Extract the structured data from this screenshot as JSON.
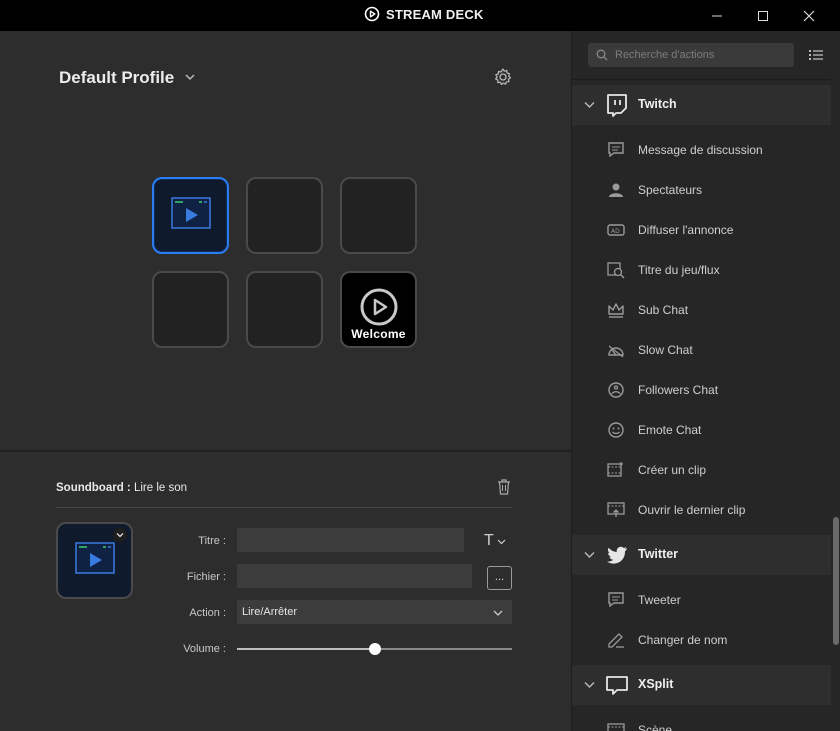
{
  "window": {
    "title": "STREAM DECK",
    "minimize_icon": "minimize-icon",
    "maximize_icon": "maximize-icon",
    "close_icon": "close-icon"
  },
  "profile": {
    "name": "Default Profile"
  },
  "keys": [
    {
      "state": "selected",
      "icon": "video-player-icon"
    },
    {
      "state": "empty"
    },
    {
      "state": "empty"
    },
    {
      "state": "empty"
    },
    {
      "state": "empty"
    },
    {
      "state": "welcome",
      "icon": "elgato-logo-icon",
      "label": "Welcome"
    }
  ],
  "properties": {
    "plugin": "Soundboard :",
    "action_name": "Lire le son",
    "fields": {
      "title_label": "Titre :",
      "title_value": "",
      "file_label": "Fichier :",
      "file_value": "",
      "browse_label": "...",
      "action_label": "Action :",
      "action_value": "Lire/Arrêter",
      "volume_label": "Volume :",
      "volume_level": 0.5
    },
    "title_font_button": "T"
  },
  "sidebar": {
    "search_placeholder": "Recherche d'actions",
    "categories": [
      {
        "name": "Twitch",
        "icon": "twitch-icon",
        "items": [
          {
            "label": "Message de discussion",
            "icon": "chat-message-icon"
          },
          {
            "label": "Spectateurs",
            "icon": "viewers-icon"
          },
          {
            "label": "Diffuser l'annonce",
            "icon": "ad-broadcast-icon"
          },
          {
            "label": "Titre du jeu/flux",
            "icon": "stream-title-icon"
          },
          {
            "label": "Sub Chat",
            "icon": "crown-icon"
          },
          {
            "label": "Slow Chat",
            "icon": "slow-chat-icon"
          },
          {
            "label": "Followers Chat",
            "icon": "followers-chat-icon"
          },
          {
            "label": "Emote Chat",
            "icon": "emote-icon"
          },
          {
            "label": "Créer un clip",
            "icon": "create-clip-icon"
          },
          {
            "label": "Ouvrir le dernier clip",
            "icon": "open-clip-icon"
          }
        ]
      },
      {
        "name": "Twitter",
        "icon": "twitter-bird-icon",
        "items": [
          {
            "label": "Tweeter",
            "icon": "tweet-icon"
          },
          {
            "label": "Changer de nom",
            "icon": "change-name-icon"
          }
        ]
      },
      {
        "name": "XSplit",
        "icon": "xsplit-icon",
        "items": [
          {
            "label": "Scène",
            "icon": "scene-icon"
          }
        ]
      }
    ]
  }
}
